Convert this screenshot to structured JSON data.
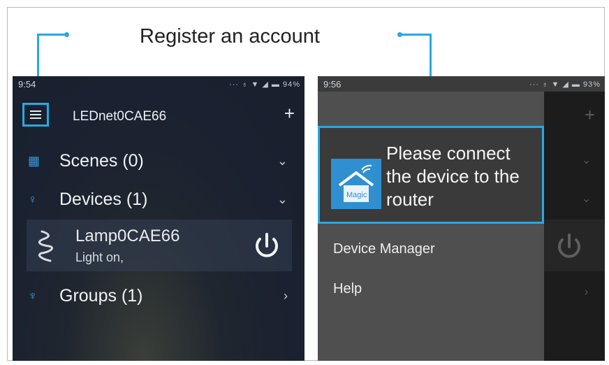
{
  "annotation": {
    "caption": "Register an account",
    "accent_color": "#29a8e0"
  },
  "left_screen": {
    "status": {
      "time": "9:54",
      "battery": "94%"
    },
    "header": {
      "menu_icon": "hamburger-icon",
      "title": "LEDnet0CAE66",
      "add_icon": "plus-icon"
    },
    "sections": [
      {
        "icon": "scenes-grid-icon",
        "label": "Scenes (0)",
        "chevron": "⌄"
      },
      {
        "icon": "bulb-icon",
        "label": "Devices (1)",
        "chevron": "⌄"
      },
      {
        "icon": "groups-icon",
        "label": "Groups (1)",
        "chevron": "›"
      }
    ],
    "device": {
      "name": "Lamp0CAE66",
      "status": "Light on,",
      "icon": "lamp-icon",
      "power_icon": "power-icon"
    }
  },
  "right_screen": {
    "status": {
      "time": "9:56",
      "battery": "93%"
    },
    "drawer": {
      "login_prompt": "Please connect the device to the router",
      "logo_icon": "magic-home-logo",
      "logo_text": "Magic",
      "items": [
        "Device Manager",
        "Help"
      ]
    }
  }
}
